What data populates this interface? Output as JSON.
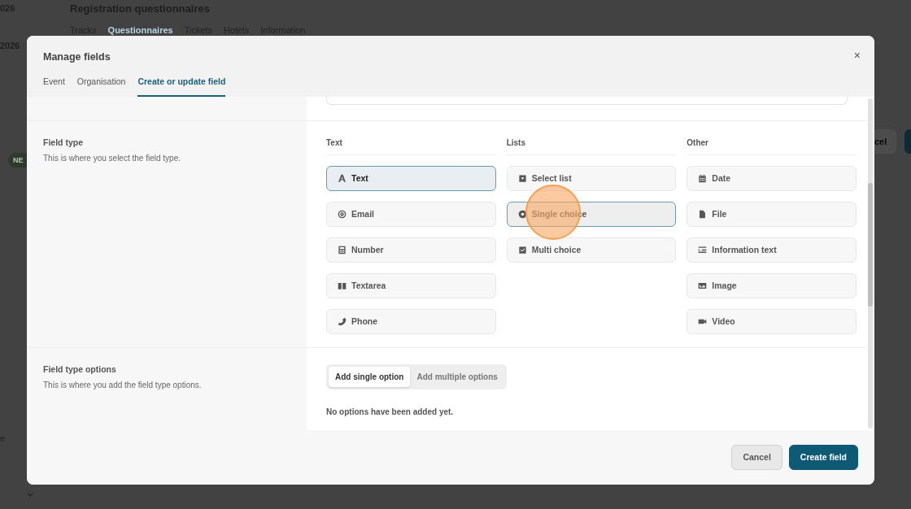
{
  "background": {
    "years": [
      "026",
      "2026"
    ],
    "title": "Registration questionnaires",
    "tabs": [
      {
        "label": "Tracks",
        "selected": false
      },
      {
        "label": "Questionnaires",
        "selected": true
      },
      {
        "label": "Tickets",
        "selected": false
      },
      {
        "label": "Hotels",
        "selected": false
      },
      {
        "label": "Information",
        "selected": false
      }
    ],
    "badge": "NE",
    "side_letter": "e",
    "button_text": "cel"
  },
  "dialog": {
    "title": "Manage fields",
    "close_label": "×",
    "tabs": [
      {
        "label": "Event",
        "selected": false
      },
      {
        "label": "Organisation",
        "selected": false
      },
      {
        "label": "Create or update field",
        "selected": true
      }
    ],
    "field_type": {
      "title": "Field type",
      "description": "This is where you select the field type.",
      "columns": [
        {
          "heading": "Text",
          "options": [
            {
              "label": "Text",
              "selected": true,
              "hovered": false
            },
            {
              "label": "Email",
              "selected": false,
              "hovered": false
            },
            {
              "label": "Number",
              "selected": false,
              "hovered": false
            },
            {
              "label": "Textarea",
              "selected": false,
              "hovered": false
            },
            {
              "label": "Phone",
              "selected": false,
              "hovered": false
            }
          ]
        },
        {
          "heading": "Lists",
          "options": [
            {
              "label": "Select list",
              "selected": false,
              "hovered": false
            },
            {
              "label": "Single choice",
              "selected": false,
              "hovered": true
            },
            {
              "label": "Multi choice",
              "selected": false,
              "hovered": false
            }
          ]
        },
        {
          "heading": "Other",
          "options": [
            {
              "label": "Date",
              "selected": false,
              "hovered": false
            },
            {
              "label": "File",
              "selected": false,
              "hovered": false
            },
            {
              "label": "Information text",
              "selected": false,
              "hovered": false
            },
            {
              "label": "Image",
              "selected": false,
              "hovered": false
            },
            {
              "label": "Video",
              "selected": false,
              "hovered": false
            }
          ]
        }
      ]
    },
    "field_type_options": {
      "title": "Field type options",
      "description": "This is where you add the field type options.",
      "modes": [
        {
          "label": "Add single option",
          "selected": true
        },
        {
          "label": "Add multiple options",
          "selected": false
        }
      ],
      "empty_message": "No options have been added yet."
    },
    "buttons": [
      {
        "label": "Cancel",
        "kind": "secondary"
      },
      {
        "label": "Create field",
        "kind": "primary"
      }
    ]
  }
}
